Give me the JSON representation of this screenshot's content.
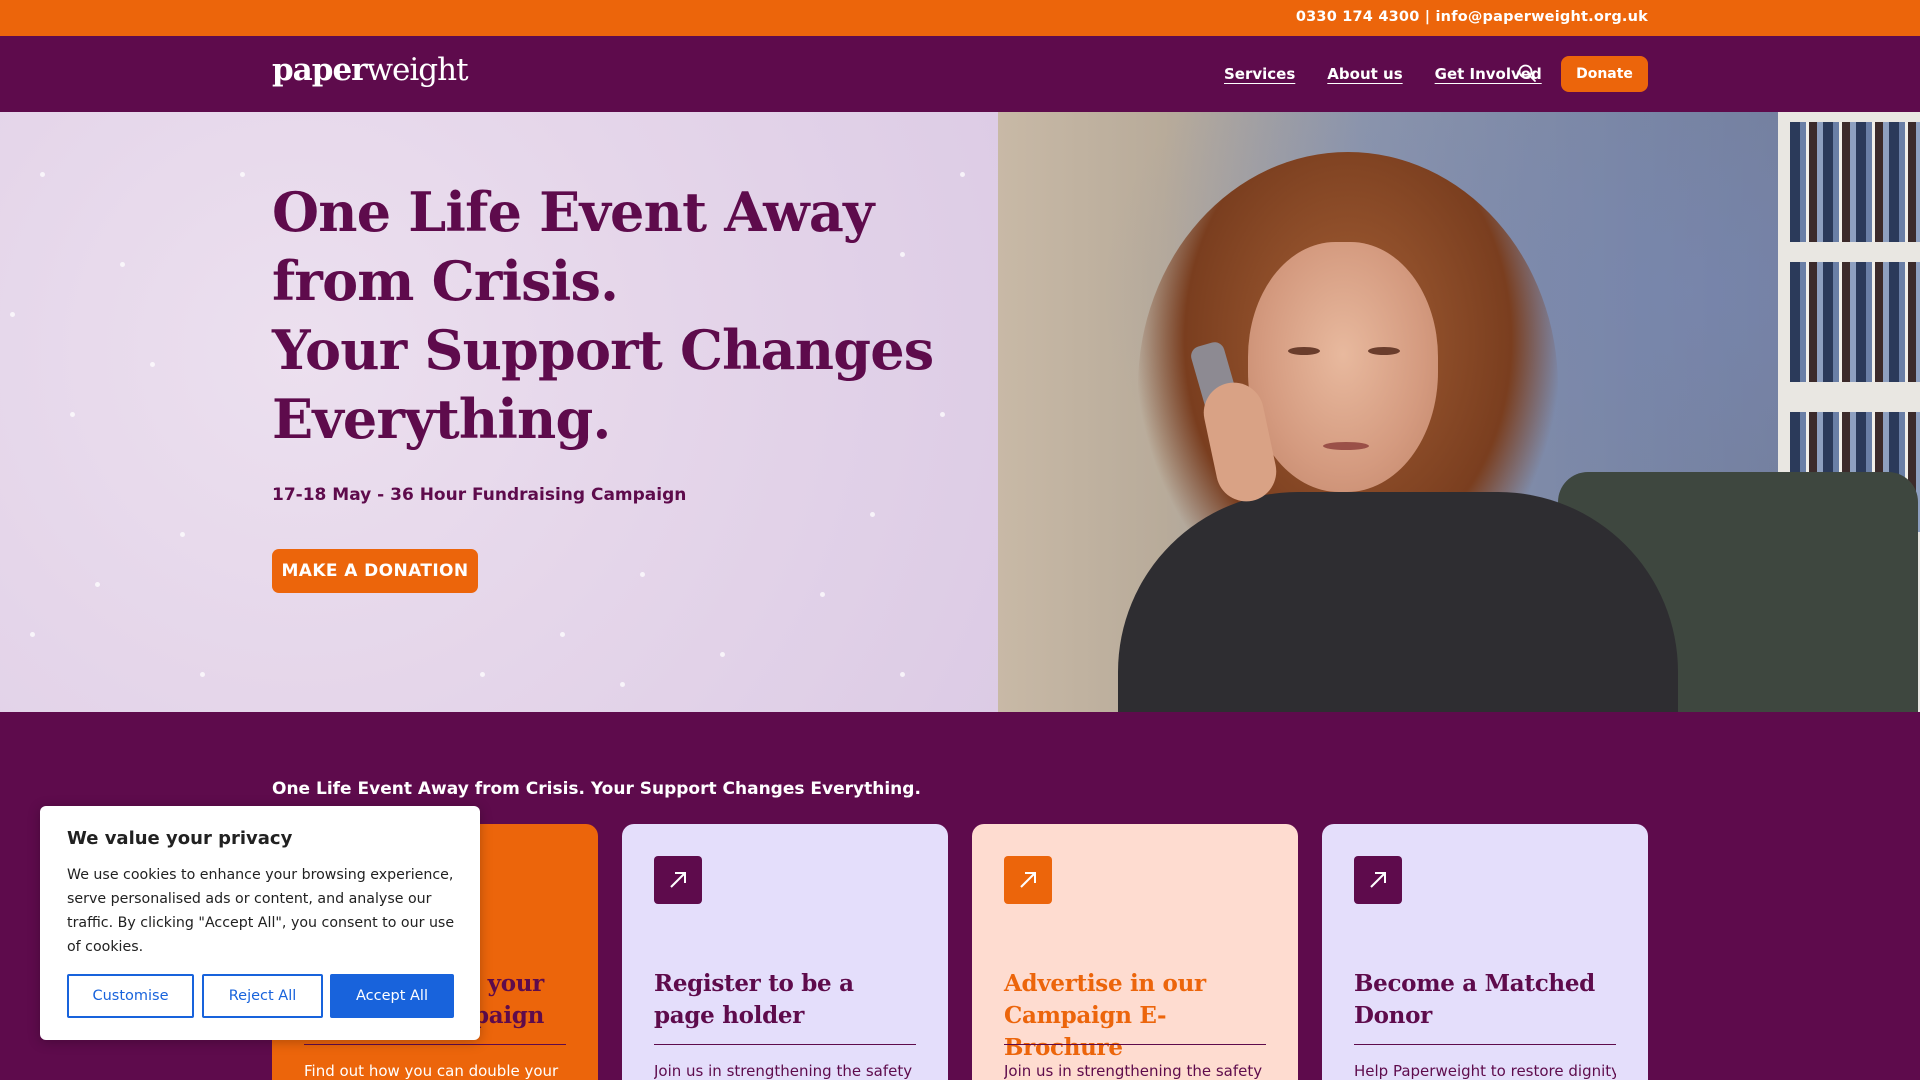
{
  "topbar": {
    "contact": "0330 174 4300 | info@paperweight.org.uk"
  },
  "nav": {
    "logo_bold": "paper",
    "logo_light": "weight",
    "links": [
      "Services",
      "About us",
      "Get Involved"
    ],
    "search_icon": "search-icon",
    "donate_label": "Donate"
  },
  "hero": {
    "title_lines": [
      "One Life Event Away",
      "from Crisis.",
      "Your Support Changes",
      "Everything."
    ],
    "subtitle": "17-18 May - 36 Hour Fundraising Campaign",
    "cta_label": "MAKE A DONATION"
  },
  "section": {
    "title": "One Life Event Away from Crisis. Your Support Changes Everything.",
    "cards": [
      {
        "title": "Double your Campaign",
        "title_partial": "our\nmpaign",
        "desc": "Find out how you can double your",
        "bg": "#ec650b",
        "title_color": "#5e0b4c",
        "desc_color": "#ffffff",
        "icon": "arrow-up-right-icon"
      },
      {
        "title": "Register to be a page holder",
        "desc": "Join us in strengthening the safety",
        "bg": "#e4defb",
        "title_color": "#5e0b4c",
        "desc_color": "#5e0b4c",
        "icon": "arrow-up-right-icon"
      },
      {
        "title": "Advertise in our Campaign E-Brochure",
        "desc": "Join us in strengthening the safety",
        "bg": "#fedcd0",
        "title_color": "#ec650b",
        "desc_color": "#5e0b4c",
        "icon": "arrow-up-right-icon"
      },
      {
        "title": "Become a Matched Donor",
        "desc": "Help Paperweight to restore dignity,",
        "bg": "#e4defb",
        "title_color": "#5e0b4c",
        "desc_color": "#5e0b4c",
        "icon": "arrow-up-right-icon"
      }
    ]
  },
  "cookie": {
    "title": "We value your privacy",
    "body": "We use cookies to enhance your browsing experience, serve personalised ads or content, and analyse our traffic. By clicking \"Accept All\", you consent to our use of cookies.",
    "customise_label": "Customise",
    "reject_label": "Reject All",
    "accept_label": "Accept All"
  },
  "colors": {
    "brand_purple": "#5e0b4c",
    "brand_orange": "#ec650b",
    "cookie_blue": "#1863dc"
  }
}
